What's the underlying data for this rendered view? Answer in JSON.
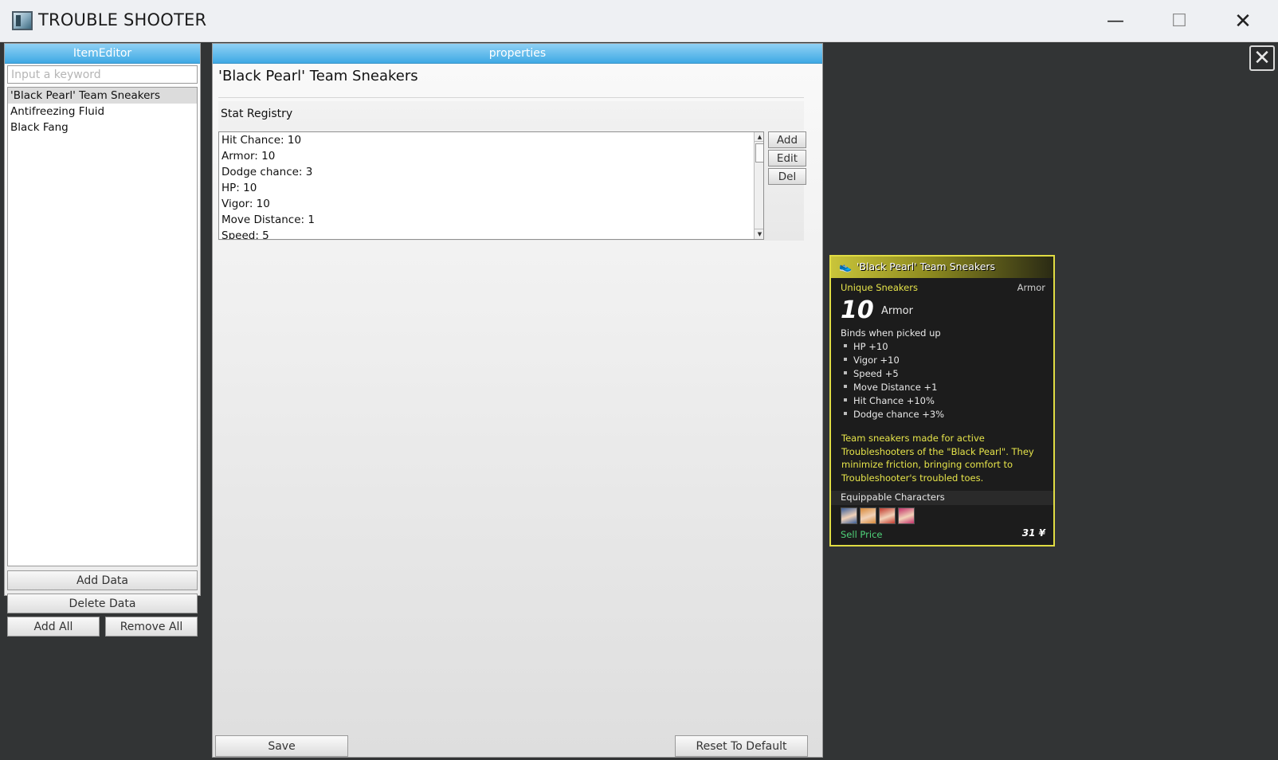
{
  "window": {
    "title": "TROUBLE SHOOTER",
    "minimize_glyph": "—",
    "maximize_glyph": "☐",
    "close_glyph": "✕"
  },
  "left_panel": {
    "header": "ItemEditor",
    "search_placeholder": "Input a keyword",
    "items": [
      {
        "label": "'Black Pearl' Team Sneakers",
        "selected": true
      },
      {
        "label": "Antifreezing Fluid",
        "selected": false
      },
      {
        "label": "Black Fang",
        "selected": false
      }
    ],
    "add_data_label": "Add Data",
    "delete_data_label": "Delete Data",
    "add_all_label": "Add All",
    "remove_all_label": "Remove All"
  },
  "properties": {
    "header": "properties",
    "title": "'Black Pearl' Team Sneakers",
    "stat_registry_label": "Stat Registry",
    "stats": [
      "Hit Chance: 10",
      "Armor: 10",
      "Dodge chance: 3",
      "HP: 10",
      "Vigor: 10",
      "Move Distance: 1",
      "Speed: 5"
    ],
    "add_label": "Add",
    "edit_label": "Edit",
    "del_label": "Del",
    "save_label": "Save",
    "reset_label": "Reset To Default"
  },
  "overlay": {
    "close_glyph": "✕"
  },
  "card": {
    "name": "'Black Pearl' Team Sneakers",
    "rarity": "Unique Sneakers",
    "category": "Armor",
    "big_value": "10",
    "big_label": "Armor",
    "binds": "Binds when picked up",
    "stats": [
      "HP  +10",
      "Vigor  +10",
      "Speed  +5",
      "Move Distance  +1",
      "Hit Chance  +10%",
      "Dodge chance  +3%"
    ],
    "description": "Team sneakers made for active Troubleshooters of the \"Black Pearl\". They minimize friction, bringing comfort to Troubleshooter's troubled toes.",
    "equippable_label": "Equippable Characters",
    "portrait_colors": [
      "#3b5f9a",
      "#d98a3a",
      "#c23a2e",
      "#c4306a"
    ],
    "sell_label": "Sell Price",
    "sell_value": "31 ¥",
    "accent_yellow": "#e6e44a",
    "sell_green": "#4fd37a"
  }
}
